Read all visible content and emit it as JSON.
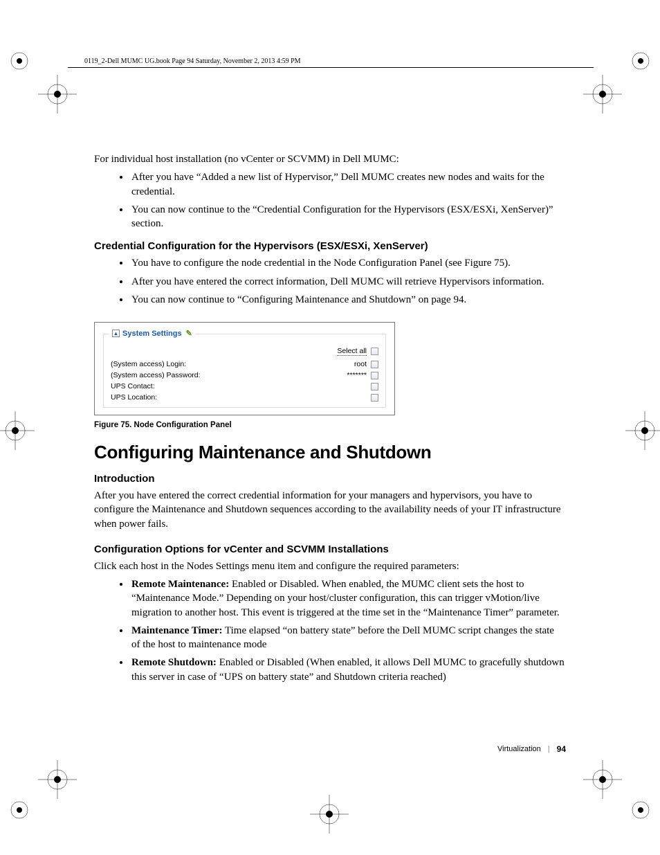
{
  "running_header": "0119_2-Dell MUMC UG.book  Page 94  Saturday, November 2, 2013  4:59 PM",
  "intro_line": "For individual host installation (no vCenter or SCVMM) in Dell MUMC:",
  "intro_bullets": [
    "After you have “Added a new list of Hypervisor,” Dell MUMC creates new nodes and waits for the credential.",
    "You can now continue to the “Credential Configuration for the Hypervisors (ESX/ESXi, XenServer)” section."
  ],
  "cred_heading": "Credential Configuration for the Hypervisors (ESX/ESXi, XenServer)",
  "cred_bullets": [
    "You have to configure the node credential in the Node Configuration Panel (see Figure 75).",
    "After you have entered the correct information, Dell MUMC will retrieve Hypervisors information.",
    "You can now continue to “Configuring Maintenance and Shutdown” on page 94."
  ],
  "panel": {
    "legend": "System Settings",
    "select_all": "Select all",
    "rows": [
      {
        "label": "(System access) Login:",
        "value": "root"
      },
      {
        "label": "(System access) Password:",
        "value": "*******"
      },
      {
        "label": "UPS Contact:",
        "value": ""
      },
      {
        "label": "UPS Location:",
        "value": ""
      }
    ]
  },
  "figure_caption": "Figure 75.  Node Configuration Panel",
  "h2": "Configuring Maintenance and Shutdown",
  "intro2_heading": "Introduction",
  "intro2_body": "After you have entered the correct credential information for your managers and hypervisors, you have to configure the Maintenance and Shutdown sequences according to the availability needs of your IT infrastructure when power fails.",
  "opts_heading": "Configuration Options for vCenter and SCVMM Installations",
  "opts_lead": "Click each host in the Nodes Settings menu item and configure the required parameters:",
  "opts_bullets": [
    {
      "term": "Remote Maintenance:",
      "text": " Enabled or Disabled. When enabled, the MUMC client sets the host to “Maintenance Mode.” Depending on your host/cluster configuration, this can trigger vMotion/live migration to another host. This event is triggered at the time set in the “Maintenance Timer” parameter."
    },
    {
      "term": "Maintenance Timer:",
      "text": " Time elapsed “on battery state” before the Dell MUMC script changes the state of the host to maintenance mode"
    },
    {
      "term": "Remote Shutdown:",
      "text": " Enabled or Disabled (When enabled, it allows Dell MUMC to gracefully shutdown this server in case of “UPS on battery state” and Shutdown criteria reached)"
    }
  ],
  "footer": {
    "section": "Virtualization",
    "page": "94"
  }
}
